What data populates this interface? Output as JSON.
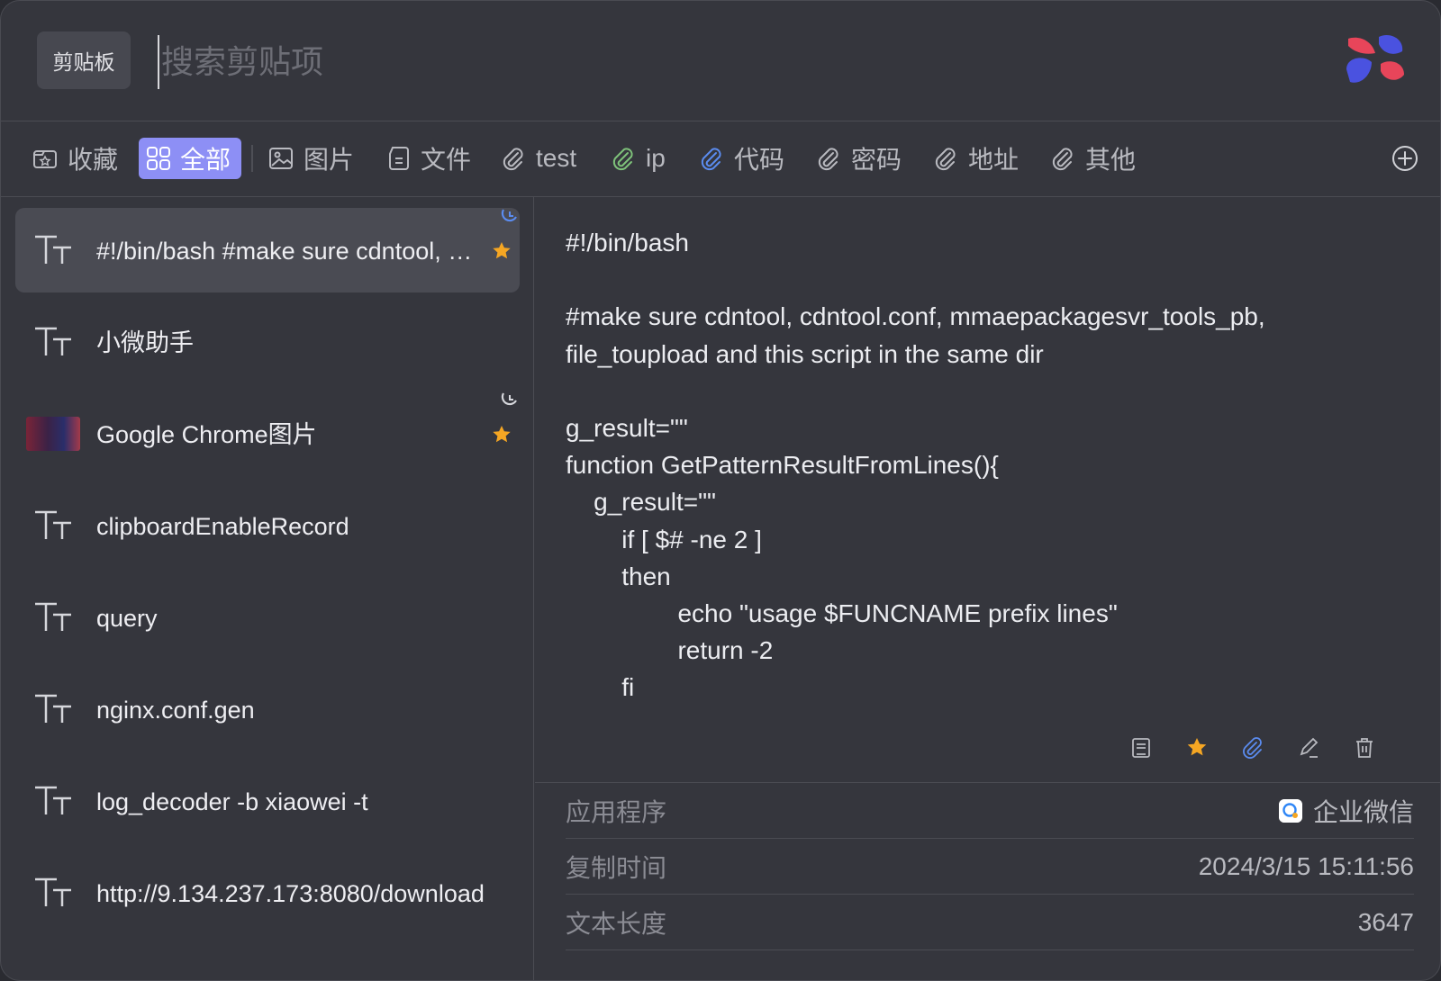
{
  "header": {
    "tag_label": "剪贴板",
    "search_placeholder": "搜索剪贴项"
  },
  "tabs": [
    {
      "label": "收藏",
      "icon": "folder-star-icon"
    },
    {
      "label": "全部",
      "icon": "grid-icon",
      "active": true
    },
    {
      "label": "图片",
      "icon": "image-icon"
    },
    {
      "label": "文件",
      "icon": "file-icon"
    },
    {
      "label": "test",
      "icon": "paperclip-icon"
    },
    {
      "label": "ip",
      "icon": "paperclip-icon",
      "color": "#7ec27a"
    },
    {
      "label": "代码",
      "icon": "paperclip-icon",
      "color": "#5b8cf0"
    },
    {
      "label": "密码",
      "icon": "paperclip-icon"
    },
    {
      "label": "地址",
      "icon": "paperclip-icon"
    },
    {
      "label": "其他",
      "icon": "paperclip-icon"
    }
  ],
  "items": [
    {
      "label": "#!/bin/bash #make sure cdntool, cdntool.conf, mmaepackagesvr_tools_pb, file_toupload and this script in the same dir",
      "type": "text",
      "starred": true,
      "selected": true,
      "pinned": true
    },
    {
      "label": "小微助手",
      "type": "text"
    },
    {
      "label": "Google Chrome图片",
      "type": "image",
      "starred": true,
      "pinned": true
    },
    {
      "label": "clipboardEnableRecord",
      "type": "text"
    },
    {
      "label": "query",
      "type": "text"
    },
    {
      "label": "nginx.conf.gen",
      "type": "text"
    },
    {
      "label": "log_decoder -b xiaowei -t",
      "type": "text"
    },
    {
      "label": "http://9.134.237.173:8080/download",
      "type": "text"
    }
  ],
  "content": {
    "text": "#!/bin/bash\n\n#make sure cdntool, cdntool.conf, mmaepackagesvr_tools_pb,\nfile_toupload and this script in the same dir\n\ng_result=\"\"\nfunction GetPatternResultFromLines(){\n    g_result=\"\"\n        if [ $# -ne 2 ]\n        then\n                echo \"usage $FUNCNAME prefix lines\"\n                return -2\n        fi"
  },
  "actions": [
    "note-icon",
    "star-icon",
    "paperclip-icon",
    "edit-icon",
    "trash-icon"
  ],
  "meta": {
    "app_label": "应用程序",
    "app_value": "企业微信",
    "time_label": "复制时间",
    "time_value": "2024/3/15 15:11:56",
    "length_label": "文本长度",
    "length_value": "3647"
  },
  "colors": {
    "accent": "#8d8ff5",
    "star": "#f5a623",
    "link_blue": "#5b8cf0",
    "ip_green": "#7ec27a"
  }
}
